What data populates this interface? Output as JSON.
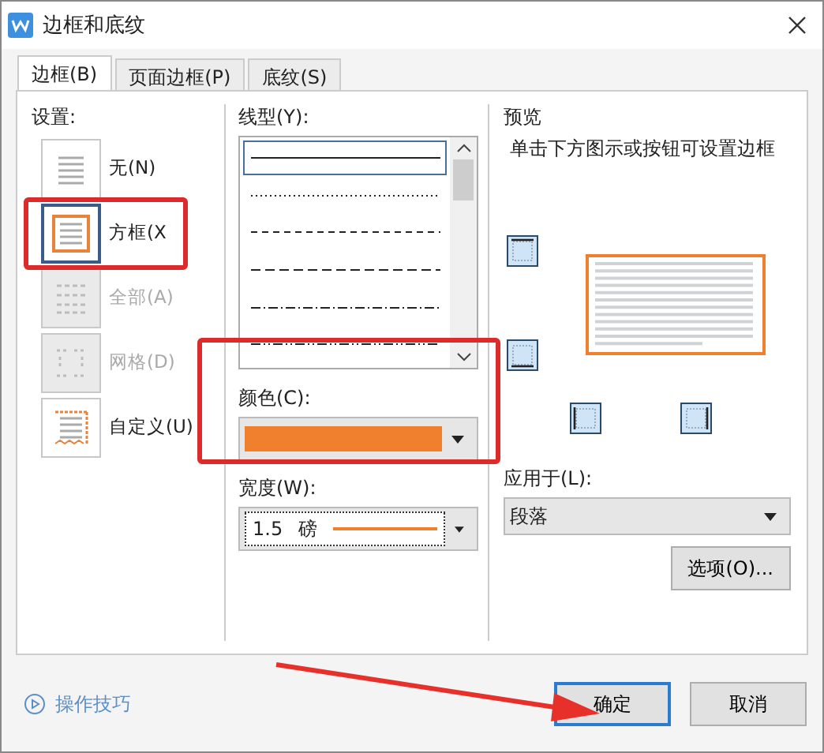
{
  "window": {
    "title": "边框和底纹"
  },
  "tabs": [
    {
      "label": "边框(B)",
      "selected": true
    },
    {
      "label": "页面边框(P)",
      "selected": false
    },
    {
      "label": "底纹(S)",
      "selected": false
    }
  ],
  "settings": {
    "label": "设置:",
    "items": [
      {
        "label": "无(N)",
        "kind": "none",
        "selected": false,
        "disabled": false
      },
      {
        "label": "方框(X",
        "kind": "box",
        "selected": true,
        "disabled": false
      },
      {
        "label": "全部(A)",
        "kind": "all",
        "selected": false,
        "disabled": true
      },
      {
        "label": "网格(D)",
        "kind": "grid",
        "selected": false,
        "disabled": true
      },
      {
        "label": "自定义(U)",
        "kind": "custom",
        "selected": false,
        "disabled": false
      }
    ]
  },
  "line_style": {
    "label": "线型(Y):",
    "items": [
      {
        "kind": "solid",
        "selected": true
      },
      {
        "kind": "dotted",
        "selected": false
      },
      {
        "kind": "dashed",
        "selected": false
      },
      {
        "kind": "longdash",
        "selected": false
      },
      {
        "kind": "dashdot",
        "selected": false
      },
      {
        "kind": "dashdotdot",
        "selected": false
      }
    ]
  },
  "color": {
    "label": "颜色(C):",
    "color": "#f0802e"
  },
  "width": {
    "label": "宽度(W):",
    "value": "1.5",
    "unit": "磅"
  },
  "preview": {
    "label": "预览",
    "hint": "单击下方图示或按钮可设置边框"
  },
  "apply_to": {
    "label": "应用于(L):",
    "value": "段落"
  },
  "options_button": "选项(O)...",
  "tips_link": "操作技巧",
  "buttons": [
    {
      "label": "确定",
      "kind": "primary"
    },
    {
      "label": "取消",
      "kind": "default"
    }
  ]
}
